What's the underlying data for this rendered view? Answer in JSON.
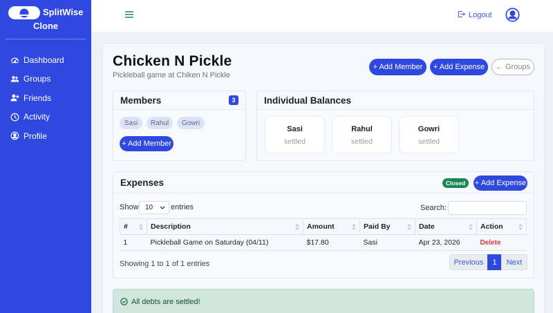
{
  "sidebar": {
    "brand_line1": "SplitWise",
    "brand_line2": "Clone",
    "items": [
      {
        "label": "Dashboard",
        "icon": "gauge-icon"
      },
      {
        "label": "Groups",
        "icon": "users-icon"
      },
      {
        "label": "Friends",
        "icon": "user-plus-icon"
      },
      {
        "label": "Activity",
        "icon": "clock-icon"
      },
      {
        "label": "Profile",
        "icon": "user-circle-icon"
      }
    ]
  },
  "topbar": {
    "logout_label": "Logout"
  },
  "group": {
    "title": "Chicken N Pickle",
    "subtitle": "Pickleball game at Chiken N Pickle"
  },
  "header_actions": {
    "add_member": "+ Add Member",
    "add_expense": "+ Add Expense",
    "back_groups": "← Groups"
  },
  "members": {
    "heading": "Members",
    "count": "3",
    "names": [
      "Sasi",
      "Rahul",
      "Gowri"
    ],
    "add_button": "+ Add Member"
  },
  "balances": {
    "heading": "Individual Balances",
    "cards": [
      {
        "name": "Sasi",
        "status": "settled"
      },
      {
        "name": "Rahul",
        "status": "settled"
      },
      {
        "name": "Gowri",
        "status": "settled"
      }
    ]
  },
  "expenses": {
    "heading": "Expenses",
    "status_badge": "Closed",
    "add_button": "+ Add Expense",
    "show_label": "Show",
    "page_size": "10",
    "entries_label": "entries",
    "search_label": "Search:",
    "search_value": "",
    "columns": [
      "#",
      "Description",
      "Amount",
      "Paid By",
      "Date",
      "Action"
    ],
    "rows": [
      {
        "num": "1",
        "description": "Pickleball Game on Saturday (04/11)",
        "amount": "$17.80",
        "paid_by": "Sasi",
        "date": "Apr 23, 2026",
        "action": "Delete"
      }
    ],
    "info": "Showing 1 to 1 of 1 entries",
    "pager": {
      "previous": "Previous",
      "current": "1",
      "next": "Next"
    }
  },
  "alert": {
    "message": "All debts are settled!"
  },
  "colors": {
    "primary": "#2f49e0",
    "success": "#198754",
    "danger": "#dc3545",
    "alert_bg": "#d1e7dd"
  }
}
